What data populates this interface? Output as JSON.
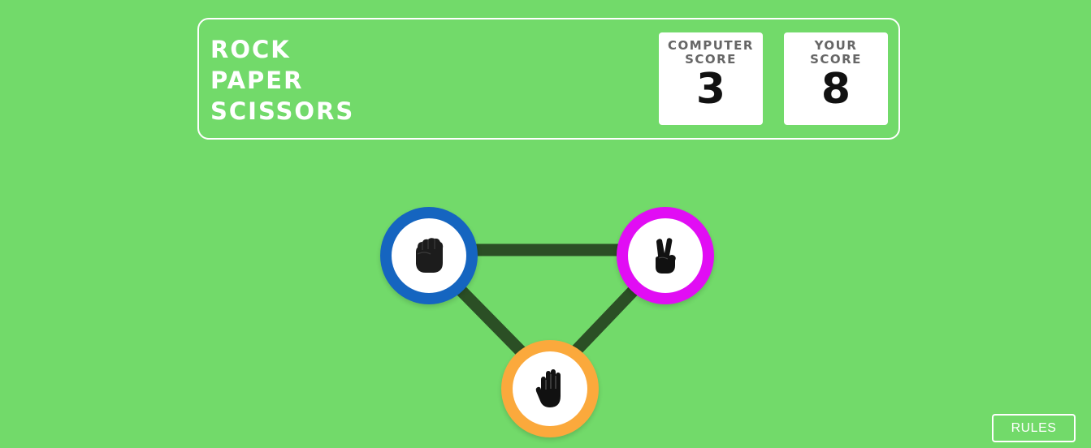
{
  "header": {
    "title_lines": [
      "ROCK",
      "PAPER",
      "SCISSORS"
    ]
  },
  "scores": {
    "computer": {
      "label": "COMPUTER\nSCORE",
      "value": "3"
    },
    "player": {
      "label": "YOUR\nSCORE",
      "value": "8"
    }
  },
  "choices": [
    {
      "id": "rock",
      "icon": "fist-icon",
      "ring_color": "#1565c0"
    },
    {
      "id": "scissors",
      "icon": "victory-hand-icon",
      "ring_color": "#e10df4"
    },
    {
      "id": "paper",
      "icon": "open-hand-icon",
      "ring_color": "#fba93c"
    }
  ],
  "connector_color": "#2b4f25",
  "background_color": "#72da6a",
  "rules_button": {
    "label": "RULES"
  }
}
